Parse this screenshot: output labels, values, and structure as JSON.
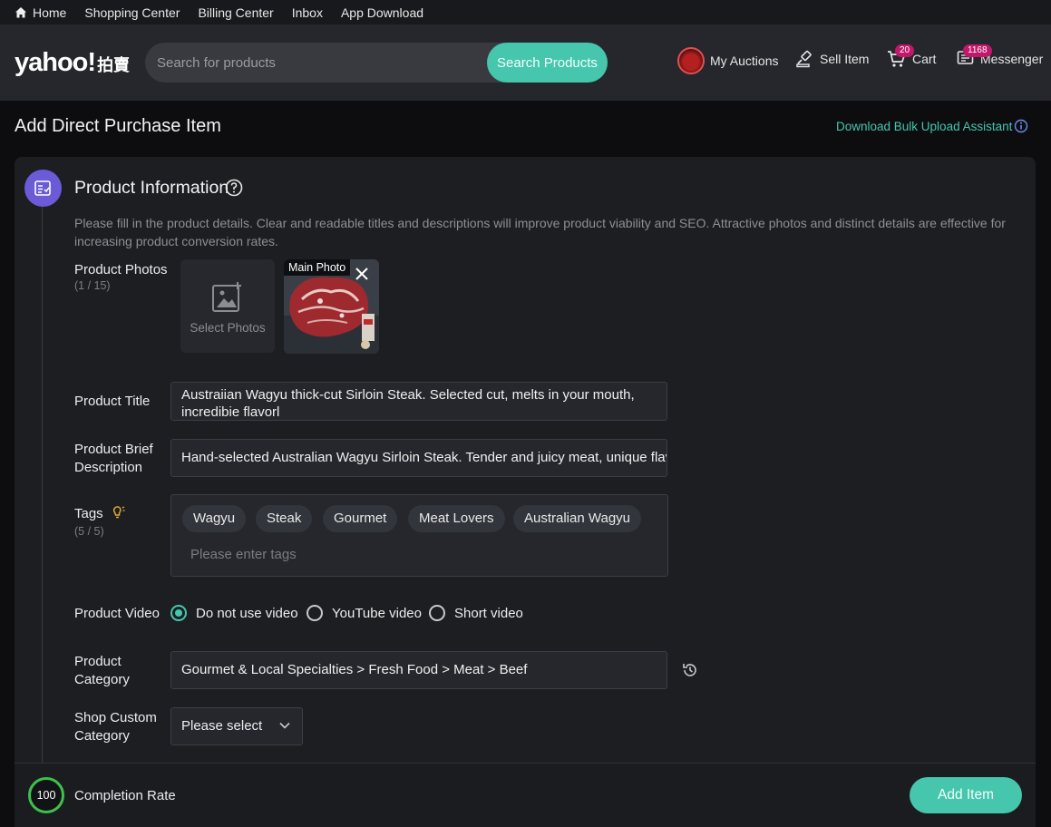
{
  "topbar": {
    "home": "Home",
    "shopping": "Shopping Center",
    "billing": "Billing Center",
    "inbox": "Inbox",
    "app": "App Download"
  },
  "header": {
    "logo": "yahoo!",
    "logo_cn": "拍賣",
    "search_placeholder": "Search for products",
    "search_button": "Search Products",
    "my_auctions": "My Auctions",
    "sell_item": "Sell Item",
    "cart": "Cart",
    "cart_count": "20",
    "messenger": "Messenger",
    "messenger_count": "1168"
  },
  "page": {
    "title": "Add Direct Purchase Item",
    "bulk_link": "Download Bulk Upload Assistant"
  },
  "section": {
    "title": "Product Information",
    "intro": "Please fill in the product details. Clear and readable titles and descriptions will improve product viability and SEO. Attractive photos and distinct details are effective for increasing product conversion rates."
  },
  "photos": {
    "label": "Product Photos",
    "count": "(1 / 15)",
    "select_label": "Select Photos",
    "main_tag": "Main Photo"
  },
  "product_title": {
    "label": "Product Title",
    "value": "Austraiian Wagyu thick-cut Sirloin Steak. Selected cut, melts in your mouth, incredibie flavorl"
  },
  "brief": {
    "label": "Product Brief Description",
    "value": "Hand-selected Australian Wagyu Sirloin Steak. Tender and juicy meat, unique flavor."
  },
  "tags": {
    "label": "Tags",
    "count": "(5 / 5)",
    "chips": [
      "Wagyu",
      "Steak",
      "Gourmet",
      "Meat Lovers",
      "Australian Wagyu"
    ],
    "placeholder": "Please enter tags"
  },
  "video": {
    "label": "Product Video",
    "options": [
      "Do not use video",
      "YouTube video",
      "Short video"
    ],
    "selected": "Do not use video"
  },
  "category": {
    "label": "Product Category",
    "value": "Gourmet & Local Specialties > Fresh Food > Meat > Beef"
  },
  "shop_category": {
    "label": "Shop Custom Category",
    "value": "Please select"
  },
  "footer": {
    "completion_value": "100",
    "completion_label": "Completion Rate",
    "add_button": "Add Item"
  },
  "colors": {
    "accent": "#45c6ad",
    "section_icon": "#6b5bd6",
    "badge": "#c2186b",
    "progress": "#3fbf4b"
  }
}
